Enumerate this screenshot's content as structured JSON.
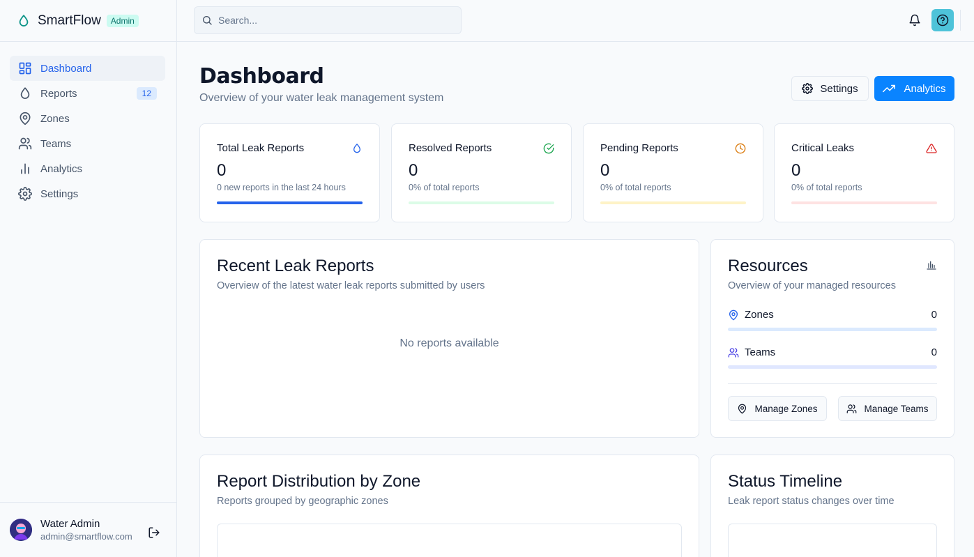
{
  "app": {
    "name": "SmartFlow",
    "badge": "Admin"
  },
  "sidebar": {
    "items": [
      {
        "label": "Dashboard",
        "icon": "dashboard-icon",
        "active": true
      },
      {
        "label": "Reports",
        "icon": "droplet-icon",
        "count": "12"
      },
      {
        "label": "Zones",
        "icon": "map-pin-icon"
      },
      {
        "label": "Teams",
        "icon": "users-icon"
      },
      {
        "label": "Analytics",
        "icon": "bar-chart-icon"
      },
      {
        "label": "Settings",
        "icon": "gear-icon"
      }
    ]
  },
  "user": {
    "name": "Water Admin",
    "email": "admin@smartflow.com"
  },
  "search": {
    "placeholder": "Search..."
  },
  "page": {
    "title": "Dashboard",
    "subtitle": "Overview of your water leak management system",
    "settings_label": "Settings",
    "analytics_label": "Analytics"
  },
  "stats": [
    {
      "title": "Total Leak Reports",
      "value": "0",
      "desc": "0 new reports in the last 24 hours",
      "icon": "droplet-icon",
      "color": "#2563eb",
      "bar_color": "#2563eb"
    },
    {
      "title": "Resolved Reports",
      "value": "0",
      "desc": "0% of total reports",
      "icon": "check-circle-icon",
      "color": "#16a34a",
      "bar_color": "#dcfce7"
    },
    {
      "title": "Pending Reports",
      "value": "0",
      "desc": "0% of total reports",
      "icon": "clock-icon",
      "color": "#d97706",
      "bar_color": "#fef3c7"
    },
    {
      "title": "Critical Leaks",
      "value": "0",
      "desc": "0% of total reports",
      "icon": "alert-triangle-icon",
      "color": "#dc2626",
      "bar_color": "#fee2e2"
    }
  ],
  "recent": {
    "title": "Recent Leak Reports",
    "subtitle": "Overview of the latest water leak reports submitted by users",
    "empty": "No reports available"
  },
  "resources": {
    "title": "Resources",
    "subtitle": "Overview of your managed resources",
    "zones_label": "Zones",
    "zones_value": "0",
    "teams_label": "Teams",
    "teams_value": "0",
    "manage_zones": "Manage Zones",
    "manage_teams": "Manage Teams"
  },
  "distribution": {
    "title": "Report Distribution by Zone",
    "subtitle": "Reports grouped by geographic zones"
  },
  "timeline": {
    "title": "Status Timeline",
    "subtitle": "Leak report status changes over time"
  },
  "colors": {
    "accent": "#0a84ff",
    "brand": "#0d9488",
    "help": "#4ec3d9"
  }
}
